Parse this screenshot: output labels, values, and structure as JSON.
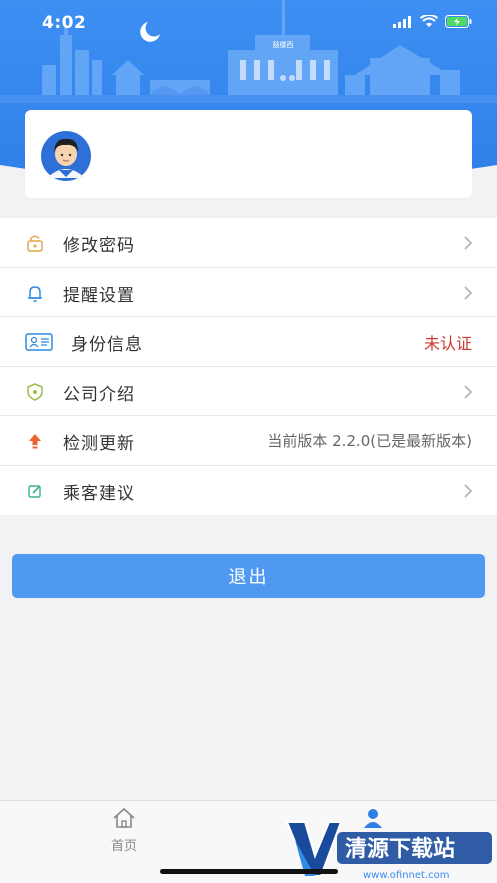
{
  "status_bar": {
    "time": "4:02"
  },
  "header": {
    "background_color": "#3b8cf0",
    "building_sign": "鼓楼西"
  },
  "menu": {
    "items": [
      {
        "label": "修改密码",
        "icon": "lock-icon",
        "value": ""
      },
      {
        "label": "提醒设置",
        "icon": "bell-icon",
        "value": ""
      },
      {
        "label": "身份信息",
        "icon": "id-card-icon",
        "value": "未认证"
      },
      {
        "label": "公司介绍",
        "icon": "shield-icon",
        "value": ""
      },
      {
        "label": "检测更新",
        "icon": "upload-icon",
        "value": "当前版本 2.2.0(已是最新版本)"
      },
      {
        "label": "乘客建议",
        "icon": "edit-icon",
        "value": ""
      }
    ]
  },
  "logout_label": "退出",
  "tab_bar": {
    "tabs": [
      {
        "label": "首页",
        "icon": "home-icon"
      },
      {
        "label": "",
        "icon": "person-icon"
      }
    ]
  },
  "watermark": {
    "text": "清源下载站",
    "url_text": "www.ofinnet.com"
  },
  "colors": {
    "accent": "#4f9af0",
    "alert": "#d0372f"
  }
}
